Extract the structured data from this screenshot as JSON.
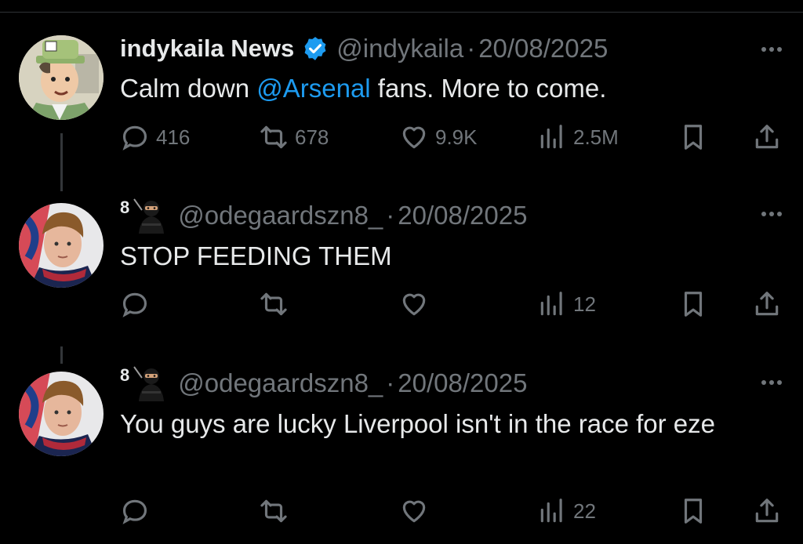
{
  "tweets": [
    {
      "display_name": "indykaila News",
      "handle": "@indykaila",
      "separator": "·",
      "date": "20/08/2025",
      "text_before": "Calm down ",
      "mention": "@Arsenal",
      "text_after": " fans. More to come.",
      "verified": true,
      "stats": {
        "replies": "416",
        "reposts": "678",
        "likes": "9.9K",
        "views": "2.5M"
      }
    },
    {
      "display_name": "8",
      "handle": "@odegaardszn8_",
      "separator": "·",
      "date": "20/08/2025",
      "text": "STOP FEEDING THEM",
      "stats": {
        "replies": "",
        "reposts": "",
        "likes": "",
        "views": "12"
      }
    },
    {
      "display_name": "8",
      "handle": "@odegaardszn8_",
      "separator": "·",
      "date": "20/08/2025",
      "text": "You guys are lucky Liverpool isn't in the race for eze",
      "stats": {
        "replies": "",
        "reposts": "",
        "likes": "",
        "views": "22"
      }
    }
  ],
  "icons": {
    "reply": "reply-icon",
    "repost": "repost-icon",
    "like": "heart-icon",
    "views": "views-icon",
    "bookmark": "bookmark-icon",
    "share": "share-icon",
    "more": "more-icon",
    "verified": "verified-badge-icon",
    "ninja": "ninja-emoji-icon"
  },
  "colors": {
    "background": "#000000",
    "text": "#e7e9ea",
    "muted": "#71767b",
    "link": "#1d9bf0"
  }
}
